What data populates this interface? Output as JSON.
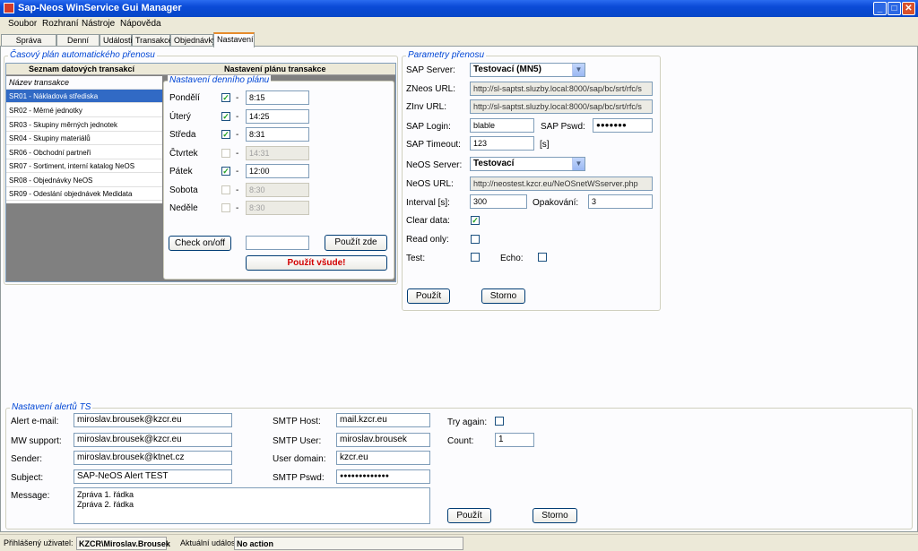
{
  "window": {
    "title": "Sap-Neos WinService Gui Manager"
  },
  "menu": [
    "Soubor",
    "Rozhraní",
    "Nástroje",
    "Nápověda"
  ],
  "tabs": [
    "Správa rozhraní",
    "Denní plán",
    "Události",
    "Transakce",
    "Objednávky",
    "Nastavení"
  ],
  "schedule": {
    "title": "Časový plán automatického přenosu",
    "header_left": "Seznam datových transakcí",
    "header_right": "Nastavení plánu transakce",
    "list_header": "Název transakce",
    "transactions": [
      "SR01 - Nákladová střediska",
      "SR02 - Měrné jednotky",
      "SR03 - Skupiny měrných jednotek",
      "SR04 - Skupiny materiálů",
      "SR06 - Obchodní partneři",
      "SR07 - Sortiment, interní katalog NeOS",
      "SR08 - Objednávky NeOS",
      "SR09 - Odeslání objednávek Medidata"
    ],
    "daily_title": "Nastavení denního plánu",
    "days": [
      {
        "name": "Pondělí",
        "checked": true,
        "time": "8:15"
      },
      {
        "name": "Úterý",
        "checked": true,
        "time": "14:25"
      },
      {
        "name": "Středa",
        "checked": true,
        "time": "8:31"
      },
      {
        "name": "Čtvrtek",
        "checked": false,
        "time": "14:31"
      },
      {
        "name": "Pátek",
        "checked": true,
        "time": "12:00"
      },
      {
        "name": "Sobota",
        "checked": false,
        "time": "8:30"
      },
      {
        "name": "Neděle",
        "checked": false,
        "time": "8:30"
      }
    ],
    "dash": "-",
    "check_btn": "Check on/off",
    "use_here_btn": "Použít zde",
    "use_all_btn": "Použít všude!",
    "use_all_color": "#d20000"
  },
  "transfer": {
    "title": "Parametry přenosu",
    "sap_server_label": "SAP Server:",
    "sap_server_value": "Testovací (MN5)",
    "zneos_label": "ZNeos URL:",
    "zneos_value": "http://sl-saptst.sluzby.local:8000/sap/bc/srt/rfc/s",
    "zinv_label": "ZInv URL:",
    "zinv_value": "http://sl-saptst.sluzby.local:8000/sap/bc/srt/rfc/s",
    "login_label": "SAP Login:",
    "login_value": "blable",
    "pswd_label": "SAP Pswd:",
    "pswd_value": "●●●●●●●",
    "timeout_label": "SAP Timeout:",
    "timeout_value": "123",
    "timeout_unit": "[s]",
    "neos_server_label": "NeOS Server:",
    "neos_server_value": "Testovací",
    "neos_url_label": "NeOS URL:",
    "neos_url_value": "http://neostest.kzcr.eu/NeOSnetWSserver.php",
    "interval_label": "Interval [s]:",
    "interval_value": "300",
    "repeat_label": "Opakování:",
    "repeat_value": "3",
    "clear_label": "Clear data:",
    "clear_checked": true,
    "readonly_label": "Read only:",
    "readonly_checked": false,
    "test_label": "Test:",
    "test_checked": false,
    "echo_label": "Echo:",
    "echo_checked": false,
    "apply_btn": "Použít",
    "cancel_btn": "Storno"
  },
  "alerts": {
    "title": "Nastavení alertů TS",
    "alert_email_label": "Alert e-mail:",
    "alert_email_value": "miroslav.brousek@kzcr.eu",
    "mw_label": "MW support:",
    "mw_value": "miroslav.brousek@kzcr.eu",
    "sender_label": "Sender:",
    "sender_value": "miroslav.brousek@ktnet.cz",
    "subject_label": "Subject:",
    "subject_value": "SAP-NeOS Alert TEST",
    "message_label": "Message:",
    "message_line1": "Zpráva 1. řádka",
    "message_line2": "Zpráva 2. řádka",
    "smtp_host_label": "SMTP Host:",
    "smtp_host_value": "mail.kzcr.eu",
    "smtp_user_label": "SMTP User:",
    "smtp_user_value": "miroslav.brousek",
    "user_domain_label": "User domain:",
    "user_domain_value": "kzcr.eu",
    "smtp_pswd_label": "SMTP Pswd:",
    "smtp_pswd_value": "●●●●●●●●●●●●●",
    "try_again_label": "Try again:",
    "try_again_checked": false,
    "count_label": "Count:",
    "count_value": "1",
    "apply_btn": "Použít",
    "cancel_btn": "Storno"
  },
  "status": {
    "user_label": "Přihlášený uživatel:",
    "user_value": "KZCR\\Miroslav.Brousek",
    "event_label": "Aktuální událost:",
    "event_value": "No action"
  }
}
